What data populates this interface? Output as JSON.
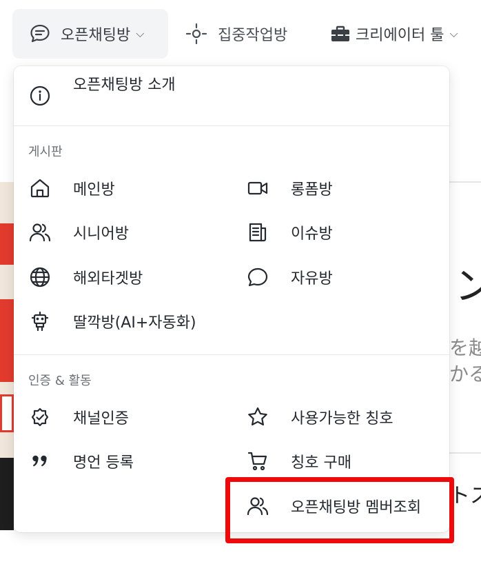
{
  "topnav": {
    "open_chat": "오픈채팅방",
    "focus_work": "집중작업방",
    "creator_tools": "크리에이터 툴",
    "caret": "⌵"
  },
  "dropdown": {
    "intro_label": "오픈채팅방 소개",
    "board_title": "게시판",
    "board_items": {
      "main": "메인방",
      "longform": "롱폼방",
      "senior": "시니어방",
      "issue": "이슈방",
      "overseas": "해외타겟방",
      "free": "자유방",
      "click": "딸깍방(AI+자동화)"
    },
    "cert_title": "인증 & 활동",
    "cert_items": {
      "channel_cert": "채널인증",
      "titles": "사용가능한 칭호",
      "quote": "명언 등록",
      "buy_title": "칭호 구매",
      "members": "오픈채팅방 멤버조회"
    }
  },
  "background": {
    "t1": "ン",
    "t2": "を越",
    "t3": "かる",
    "t4": "トス"
  },
  "colors": {
    "highlight": "#ee0a0a",
    "accent_bg": "#f3f4f6"
  }
}
